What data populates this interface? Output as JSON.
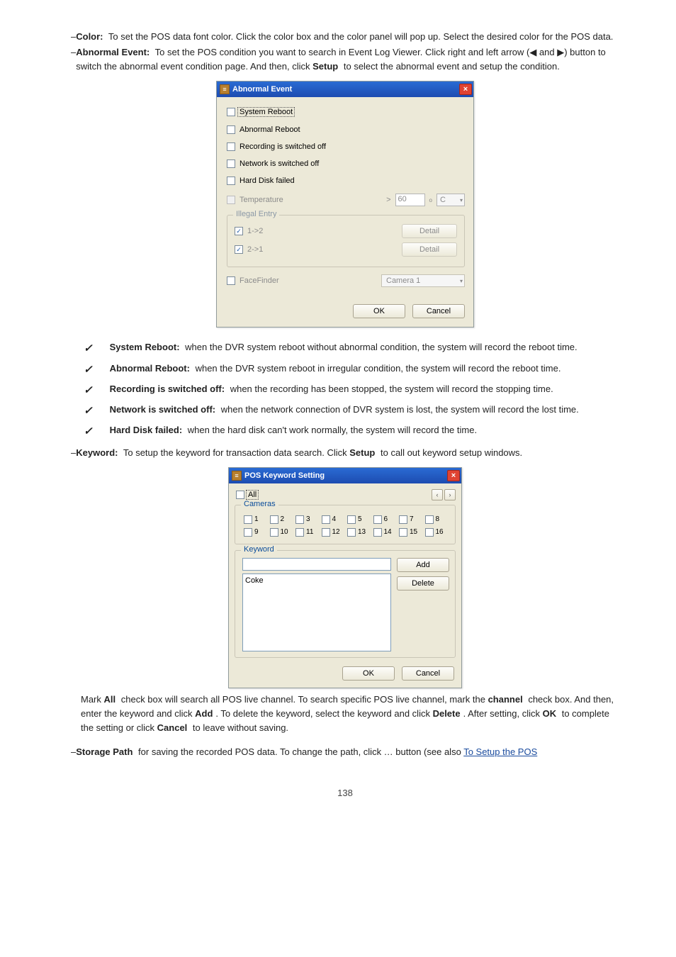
{
  "intro_items": [
    {
      "label": "Color:",
      "text": " To set the POS data font color. Click the color box and the color panel will pop up. Select the desired color for the POS data."
    },
    {
      "label": "Abnormal Event:",
      "text": " To set the POS condition you want to search in Event Log Viewer. Click right and left arrow (◀ and ▶) button to switch the abnormal event condition page. And then, click "
    },
    {
      "label": "Setup",
      "text": " to select the abnormal event and setup the condition.",
      "label_style": "plain-bold"
    }
  ],
  "abnormal_dialog": {
    "title": "Abnormal Event",
    "items": {
      "system_reboot": "System Reboot",
      "abnormal_reboot": "Abnormal Reboot",
      "recording_off": "Recording is switched off",
      "network_off": "Network is switched off",
      "hdd_failed": "Hard Disk failed",
      "temperature": "Temperature",
      "temp_val": "60",
      "temp_sup": "o",
      "temp_unit": "C"
    },
    "illegal": {
      "legend": "Illegal Entry",
      "row1": "1->2",
      "row2": "2->1",
      "detail": "Detail"
    },
    "facefinder": {
      "label": "FaceFinder",
      "camera": "Camera 1"
    },
    "ok": "OK",
    "cancel": "Cancel"
  },
  "bullets": [
    {
      "label": "System Reboot:",
      "text": " when the DVR system reboot without abnormal condition, the system will record the reboot time."
    },
    {
      "label": "Abnormal Reboot:",
      "text": " when the DVR system reboot in irregular condition, the system will record the reboot time."
    },
    {
      "label": "Recording is switched off:",
      "text": " when the recording has been stopped, the system will record the stopping time."
    },
    {
      "label": "Network is switched off:",
      "text": " when the network connection of DVR system is lost, the system will record the lost time."
    },
    {
      "label": "Hard Disk failed:",
      "text": " when the hard disk can't work normally, the system will record the time."
    }
  ],
  "para_keyword": {
    "label": "Keyword:",
    "text": " To setup the keyword for transaction data search. Click "
  },
  "para_keyword_tail": " to call out keyword setup windows.",
  "setup_word": "Setup",
  "pos_dialog": {
    "title": "POS Keyword Setting",
    "all": "All",
    "cameras_legend": "Cameras",
    "camera_numbers": [
      "1",
      "2",
      "3",
      "4",
      "5",
      "6",
      "7",
      "8",
      "9",
      "10",
      "11",
      "12",
      "13",
      "14",
      "15",
      "16"
    ],
    "keyword_legend": "Keyword",
    "list_items": [
      "Coke"
    ],
    "add": "Add",
    "delete": "Delete",
    "ok": "OK",
    "cancel": "Cancel"
  },
  "final_para_1": {
    "prefix": "Mark ",
    "bold": "All",
    "text": " check box will search all POS live channel. To search specific POS live channel, mark the "
  },
  "final_para_2": {
    "bold": "channel",
    "text": " check box. And then, enter the keyword and click "
  },
  "final_para_3": {
    "bold": "Add",
    "text": ". To delete the keyword, select the keyword and click "
  },
  "final_para_4": {
    "bold": "Delete",
    "text": ". After setting, click "
  },
  "final_para_5": {
    "bold": "OK",
    "text": " to complete the setting or click "
  },
  "final_para_6": {
    "bold": "Cancel",
    "text": " to leave without saving."
  },
  "para_storage": {
    "label": "Storage Path",
    "text": " for saving the recorded POS data. To change the path, click … button (see also "
  },
  "link_text": "To Setup the POS ",
  "footer": "138"
}
